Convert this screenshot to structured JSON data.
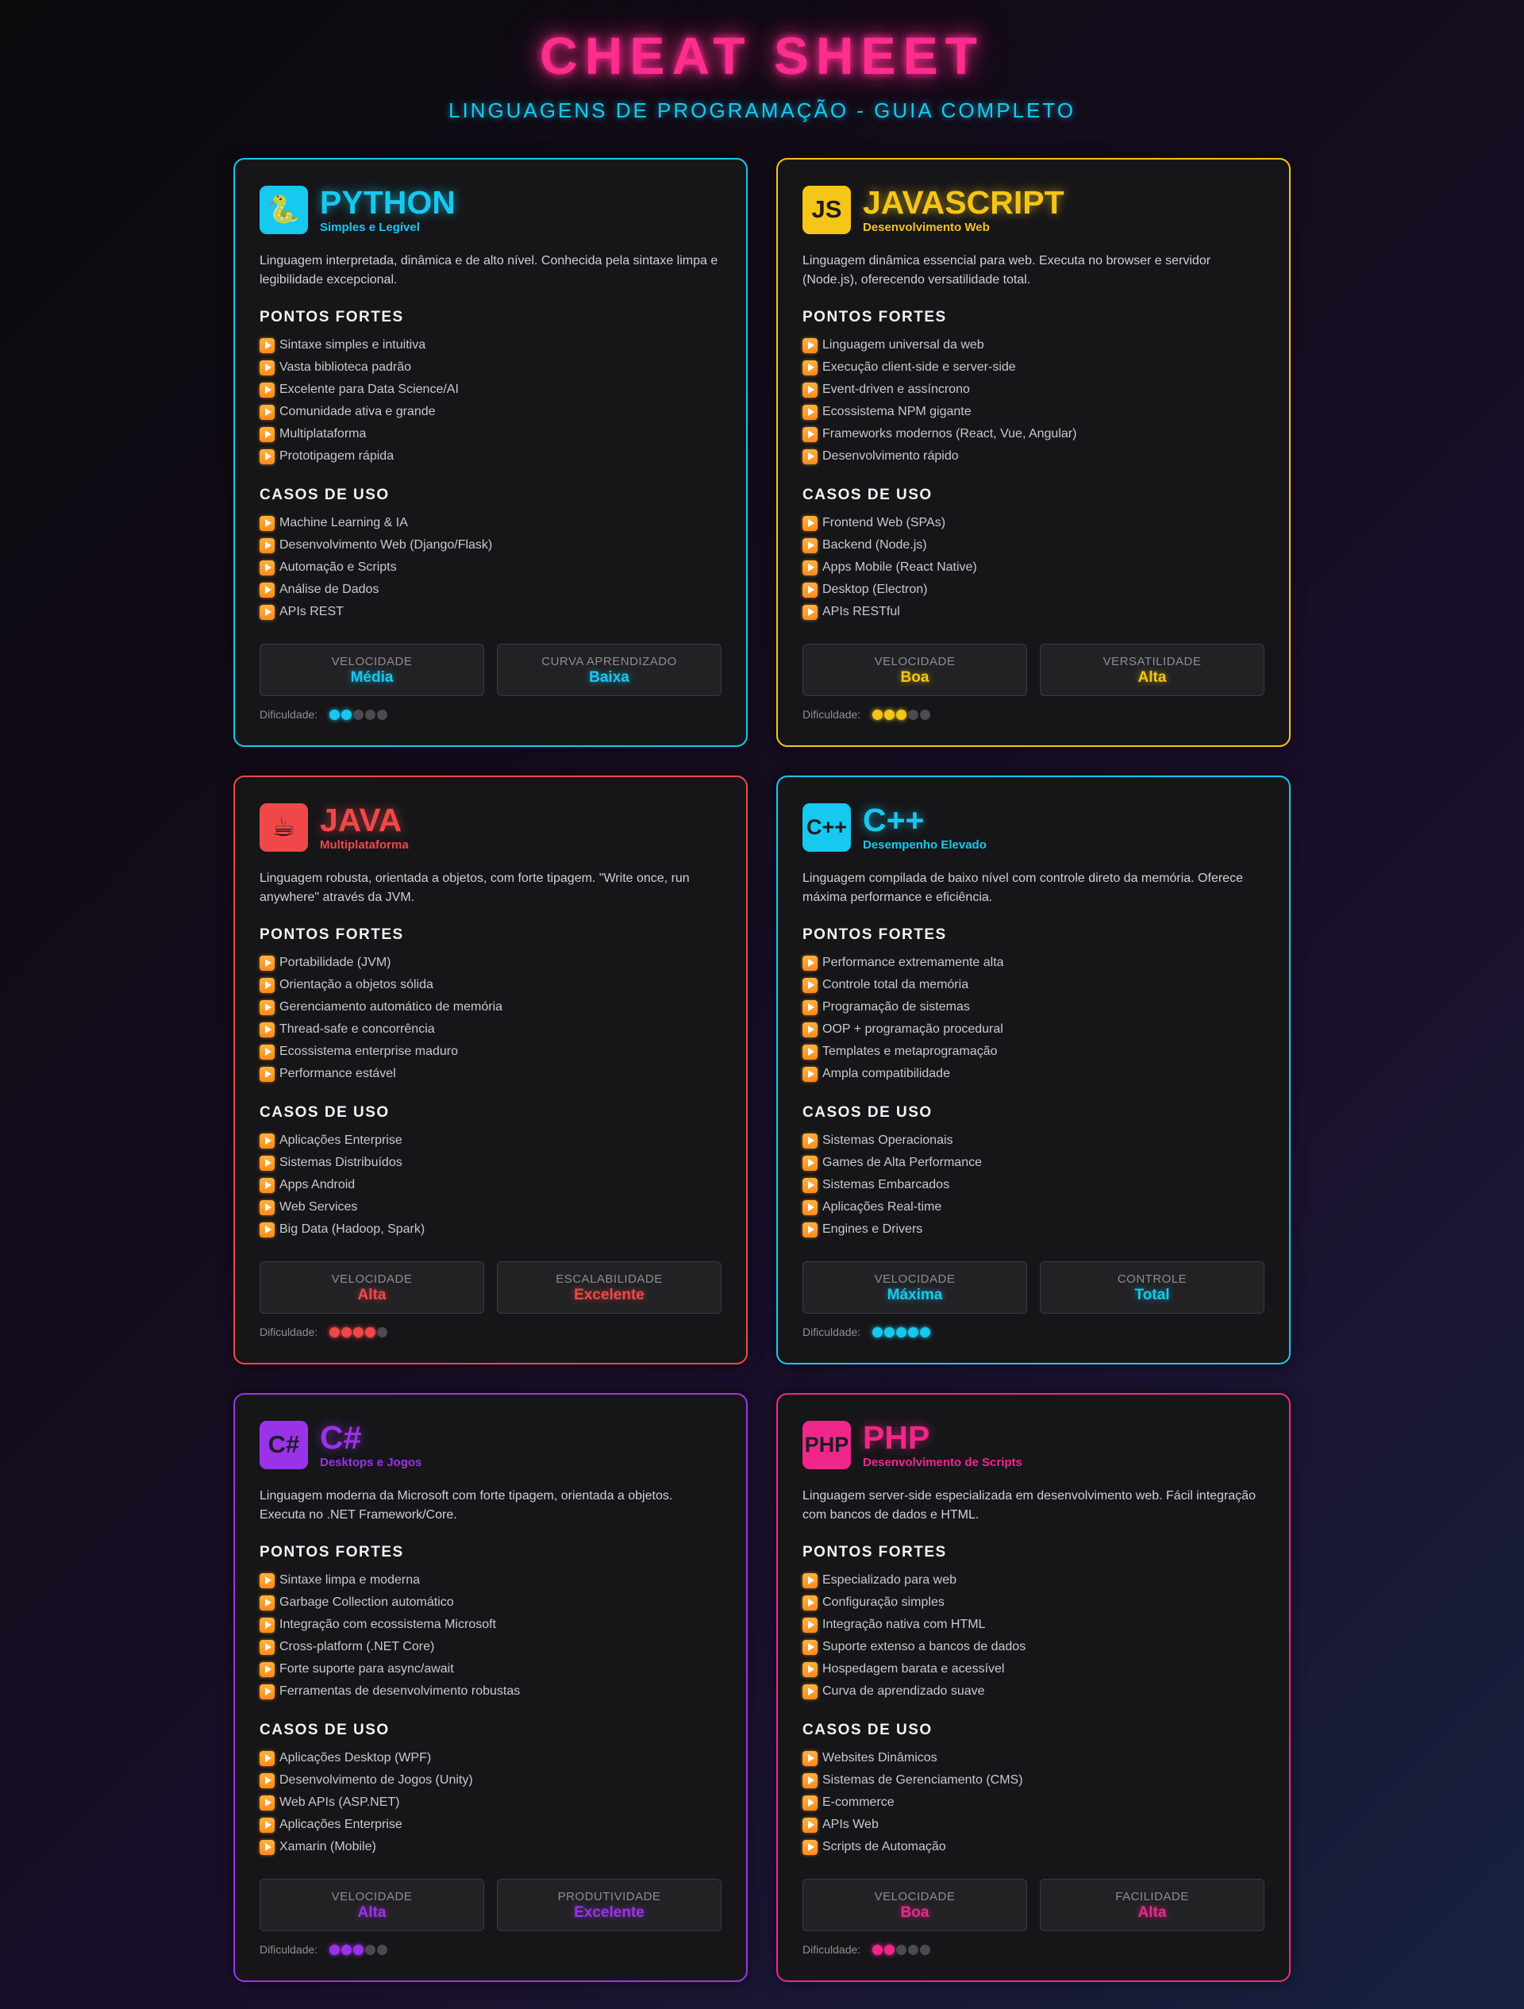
{
  "header": {
    "title": "CHEAT SHEET",
    "subtitle": "LINGUAGENS DE PROGRAMAÇÃO - GUIA COMPLETO"
  },
  "labels": {
    "strengths": "PONTOS FORTES",
    "use_cases": "CASOS DE USO",
    "difficulty": "Dificuldade:"
  },
  "cards": [
    {
      "name": "PYTHON",
      "tagline": "Simples e Legível",
      "icon": "snake-icon",
      "logo": "🐍",
      "accent": "#17c8ef",
      "description": "Linguagem interpretada, dinâmica e de alto nível. Conhecida pela sintaxe limpa e legibilidade excepcional.",
      "strengths": [
        "Sintaxe simples e intuitiva",
        "Vasta biblioteca padrão",
        "Excelente para Data Science/AI",
        "Comunidade ativa e grande",
        "Multiplataforma",
        "Prototipagem rápida"
      ],
      "use_cases": [
        "Machine Learning & IA",
        "Desenvolvimento Web (Django/Flask)",
        "Automação e Scripts",
        "Análise de Dados",
        "APIs REST"
      ],
      "stats": [
        {
          "label": "VELOCIDADE",
          "value": "Média"
        },
        {
          "label": "CURVA APRENDIZADO",
          "value": "Baixa"
        }
      ],
      "difficulty": 2
    },
    {
      "name": "JAVASCRIPT",
      "tagline": "Desenvolvimento Web",
      "icon": "js-icon",
      "logo": "JS",
      "accent": "#f5c518",
      "description": "Linguagem dinâmica essencial para web. Executa no browser e servidor (Node.js), oferecendo versatilidade total.",
      "strengths": [
        "Linguagem universal da web",
        "Execução client-side e server-side",
        "Event-driven e assíncrono",
        "Ecossistema NPM gigante",
        "Frameworks modernos (React, Vue, Angular)",
        "Desenvolvimento rápido"
      ],
      "use_cases": [
        "Frontend Web (SPAs)",
        "Backend (Node.js)",
        "Apps Mobile (React Native)",
        "Desktop (Electron)",
        "APIs RESTful"
      ],
      "stats": [
        {
          "label": "VELOCIDADE",
          "value": "Boa"
        },
        {
          "label": "VERSATILIDADE",
          "value": "Alta"
        }
      ],
      "difficulty": 3
    },
    {
      "name": "JAVA",
      "tagline": "Multiplataforma",
      "icon": "coffee-icon",
      "logo": "☕",
      "accent": "#f04848",
      "description": "Linguagem robusta, orientada a objetos, com forte tipagem. \"Write once, run anywhere\" através da JVM.",
      "strengths": [
        "Portabilidade (JVM)",
        "Orientação a objetos sólida",
        "Gerenciamento automático de memória",
        "Thread-safe e concorrência",
        "Ecossistema enterprise maduro",
        "Performance estável"
      ],
      "use_cases": [
        "Aplicações Enterprise",
        "Sistemas Distribuídos",
        "Apps Android",
        "Web Services",
        "Big Data (Hadoop, Spark)"
      ],
      "stats": [
        {
          "label": "VELOCIDADE",
          "value": "Alta"
        },
        {
          "label": "ESCALABILIDADE",
          "value": "Excelente"
        }
      ],
      "difficulty": 4
    },
    {
      "name": "C++",
      "tagline": "Desempenho Elevado",
      "icon": "cpp-icon",
      "logo": "C++",
      "accent": "#17c8ef",
      "description": "Linguagem compilada de baixo nível com controle direto da memória. Oferece máxima performance e eficiência.",
      "strengths": [
        "Performance extremamente alta",
        "Controle total da memória",
        "Programação de sistemas",
        "OOP + programação procedural",
        "Templates e metaprogramação",
        "Ampla compatibilidade"
      ],
      "use_cases": [
        "Sistemas Operacionais",
        "Games de Alta Performance",
        "Sistemas Embarcados",
        "Aplicações Real-time",
        "Engines e Drivers"
      ],
      "stats": [
        {
          "label": "VELOCIDADE",
          "value": "Máxima"
        },
        {
          "label": "CONTROLE",
          "value": "Total"
        }
      ],
      "difficulty": 5
    },
    {
      "name": "C#",
      "tagline": "Desktops e Jogos",
      "icon": "csharp-icon",
      "logo": "C#",
      "accent": "#9a33e8",
      "description": "Linguagem moderna da Microsoft com forte tipagem, orientada a objetos. Executa no .NET Framework/Core.",
      "strengths": [
        "Sintaxe limpa e moderna",
        "Garbage Collection automático",
        "Integração com ecossistema Microsoft",
        "Cross-platform (.NET Core)",
        "Forte suporte para async/await",
        "Ferramentas de desenvolvimento robustas"
      ],
      "use_cases": [
        "Aplicações Desktop (WPF)",
        "Desenvolvimento de Jogos (Unity)",
        "Web APIs (ASP.NET)",
        "Aplicações Enterprise",
        "Xamarin (Mobile)"
      ],
      "stats": [
        {
          "label": "VELOCIDADE",
          "value": "Alta"
        },
        {
          "label": "PRODUTIVIDADE",
          "value": "Excelente"
        }
      ],
      "difficulty": 3
    },
    {
      "name": "PHP",
      "tagline": "Desenvolvimento de Scripts",
      "icon": "php-icon",
      "logo": "PHP",
      "accent": "#f0268a",
      "description": "Linguagem server-side especializada em desenvolvimento web. Fácil integração com bancos de dados e HTML.",
      "strengths": [
        "Especializado para web",
        "Configuração simples",
        "Integração nativa com HTML",
        "Suporte extenso a bancos de dados",
        "Hospedagem barata e acessível",
        "Curva de aprendizado suave"
      ],
      "use_cases": [
        "Websites Dinâmicos",
        "Sistemas de Gerenciamento (CMS)",
        "E-commerce",
        "APIs Web",
        "Scripts de Automação"
      ],
      "stats": [
        {
          "label": "VELOCIDADE",
          "value": "Boa"
        },
        {
          "label": "FACILIDADE",
          "value": "Alta"
        }
      ],
      "difficulty": 2
    }
  ]
}
